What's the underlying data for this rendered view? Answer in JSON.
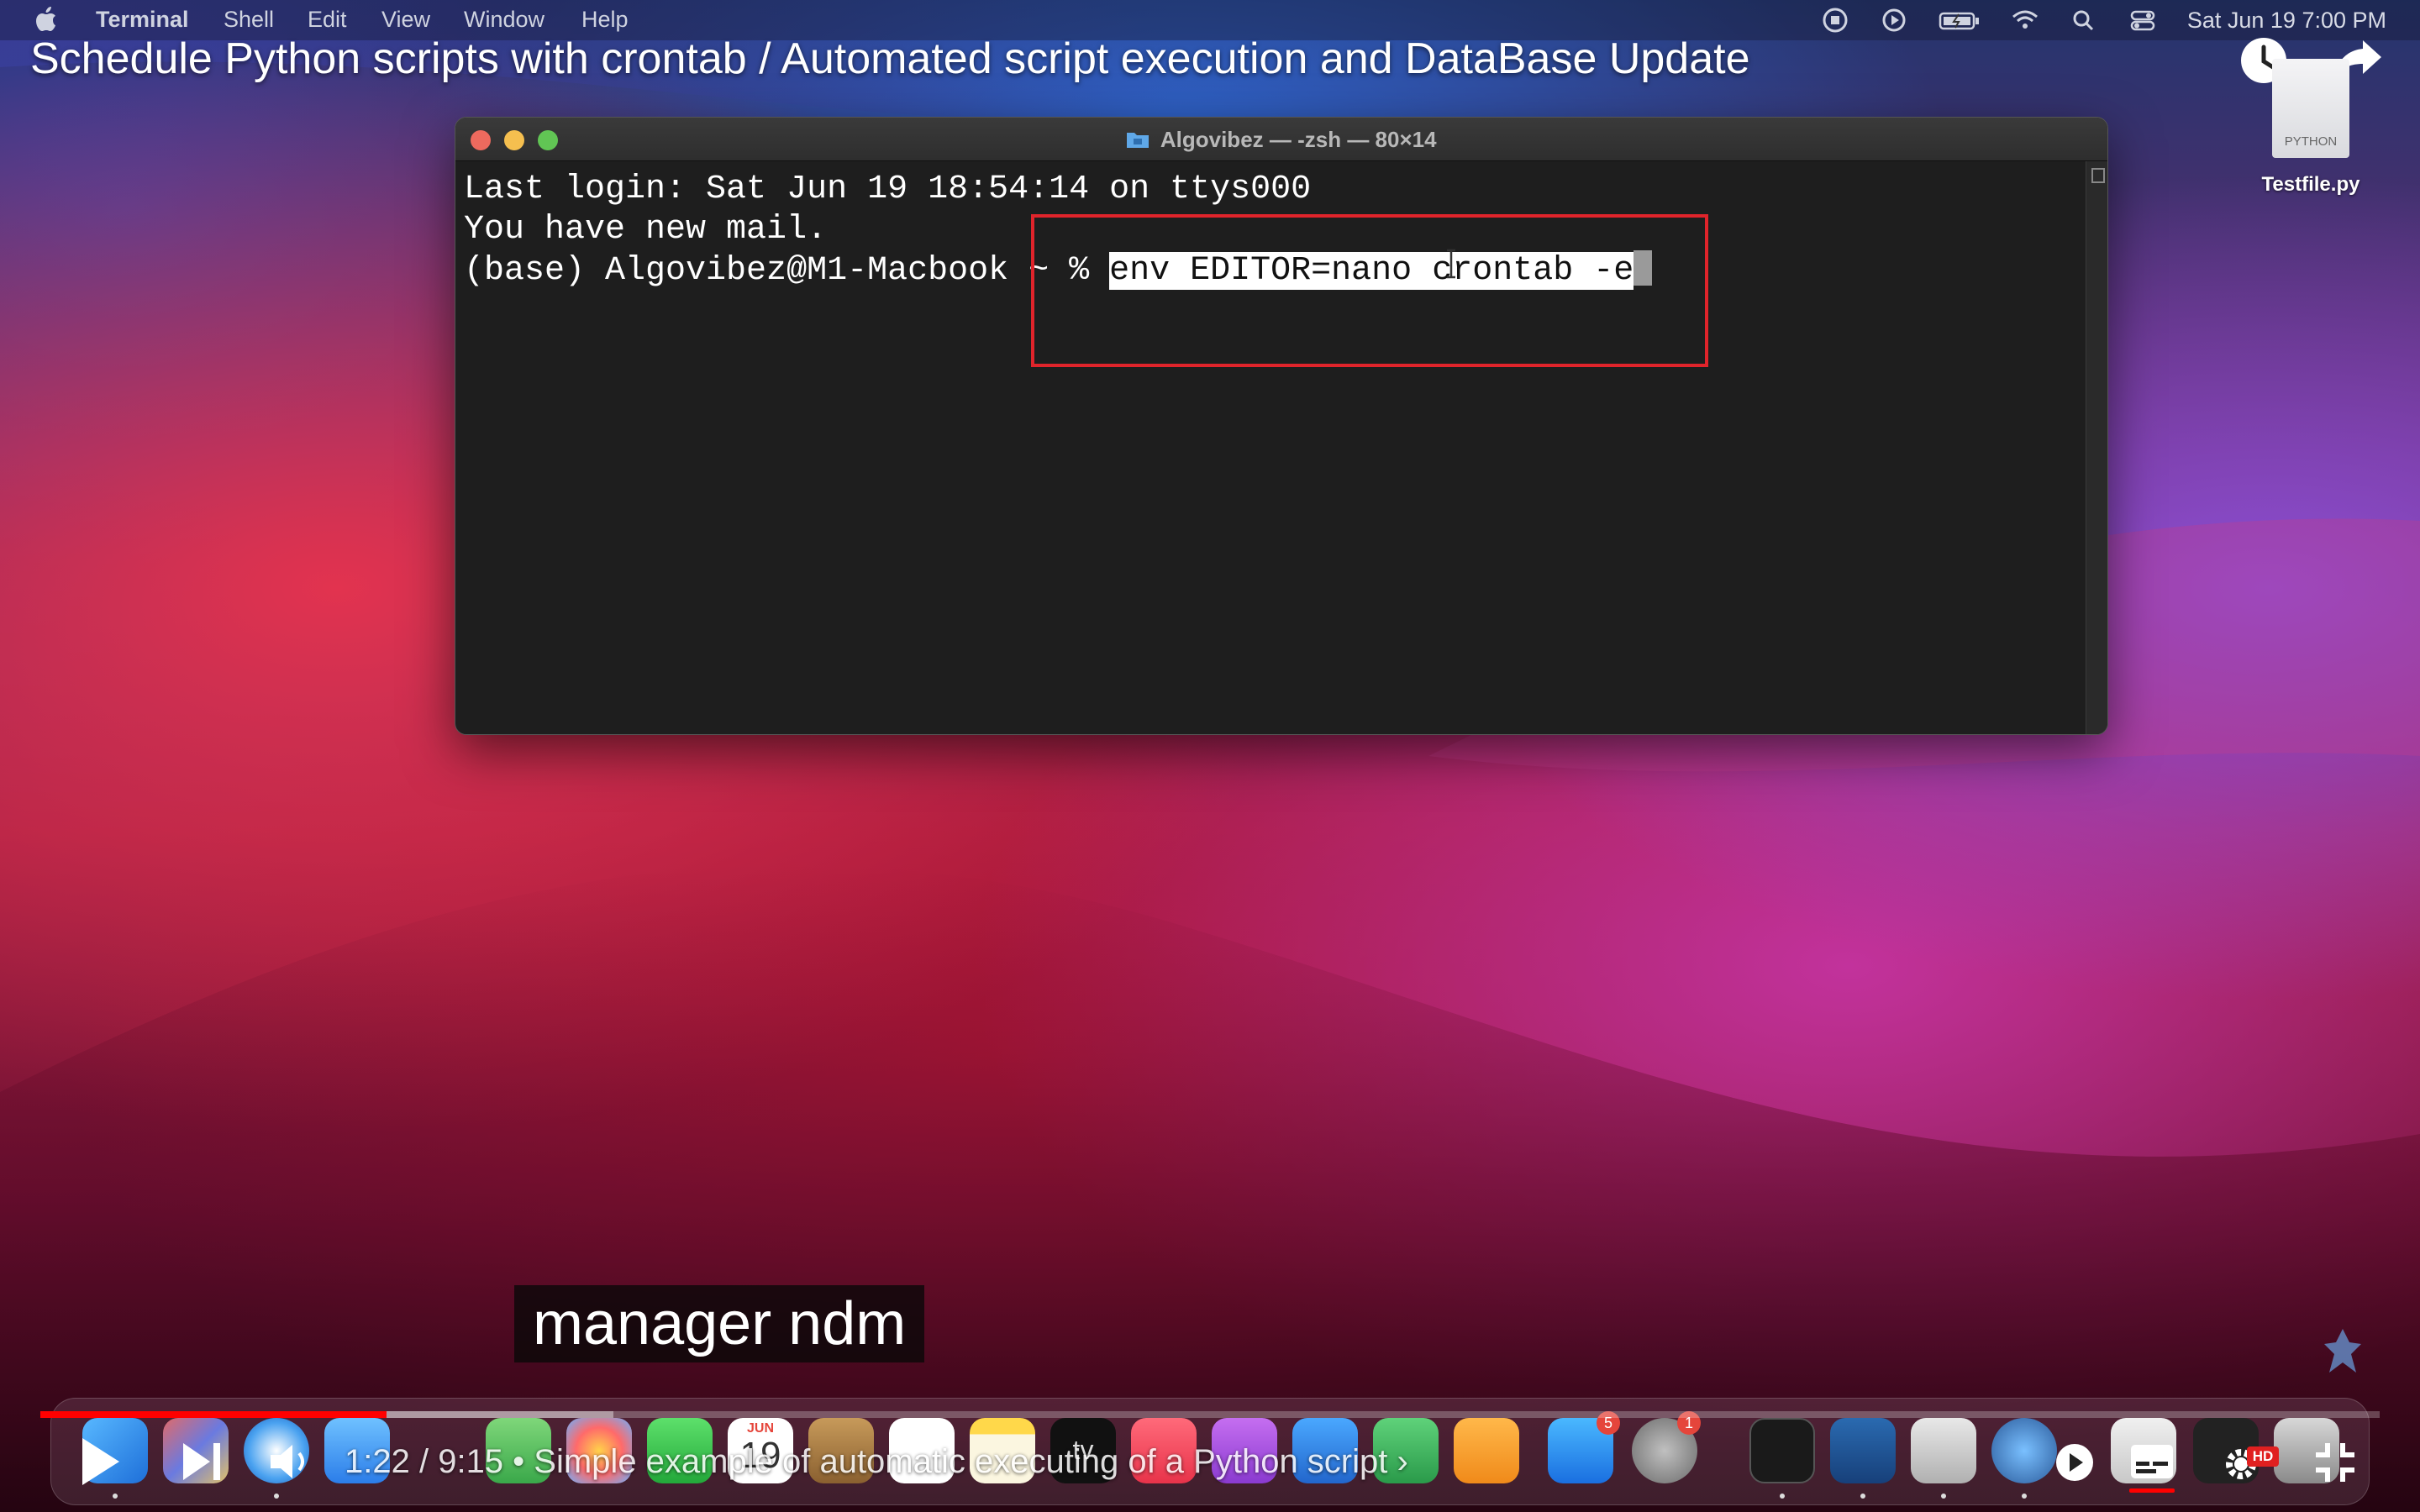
{
  "menubar": {
    "app_name": "Terminal",
    "items": [
      "Shell",
      "Edit",
      "View",
      "Window",
      "Help"
    ],
    "clock": "Sat Jun 19  7:00 PM"
  },
  "video": {
    "title": "Schedule Python scripts with crontab / Automated script execution and DataBase Update",
    "caption": "manager ndm",
    "current_time": "1:22",
    "duration": "9:15",
    "chapter": "Simple example of automatic executing of a Python script",
    "progress_played": 0.148,
    "progress_buffered": 0.245,
    "hd_label": "HD"
  },
  "desktop": {
    "file_name": "Testfile.py",
    "file_type_label": "PYTHON"
  },
  "terminal": {
    "window_title": "Algovibez — -zsh — 80×14",
    "line1": "Last login: Sat Jun 19 18:54:14 on ttys000",
    "line2": "You have new mail.",
    "prompt": "(base) Algovibez@M1-Macbook ~ % ",
    "command": "env EDITOR=nano crontab -e"
  },
  "dock": {
    "calendar_month": "JUN",
    "calendar_day": "19",
    "appstore_badge": "5",
    "settings_badge": "1",
    "tv_label": "tv"
  },
  "colors": {
    "annotation": "#e0242b",
    "progress": "#ff0000",
    "terminal_bg": "#1e1e1e"
  }
}
